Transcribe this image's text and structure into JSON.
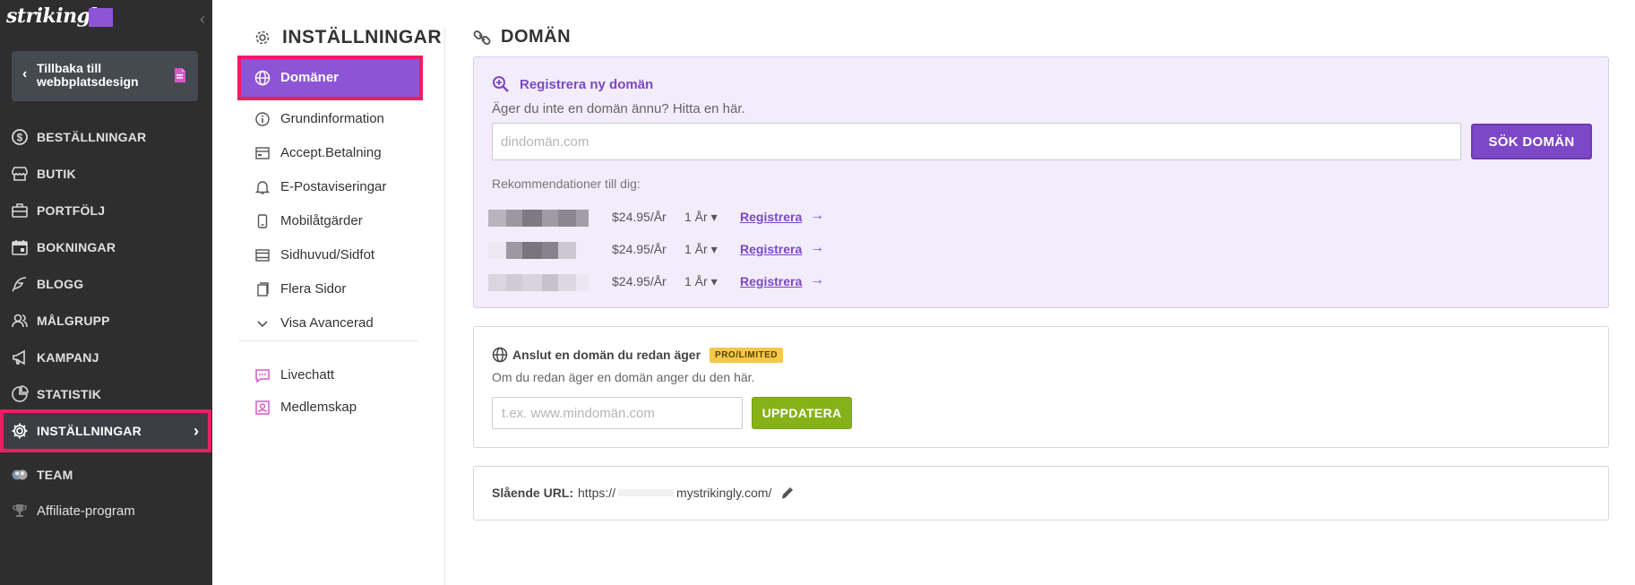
{
  "sidebar": {
    "logo": "strikingly",
    "back_label": "Tillbaka till webbplatsdesign",
    "items": [
      {
        "label": "BESTÄLLNINGAR",
        "icon": "dollar-circle-icon"
      },
      {
        "label": "BUTIK",
        "icon": "store-icon"
      },
      {
        "label": "PORTFÖLJ",
        "icon": "briefcase-icon"
      },
      {
        "label": "BOKNINGAR",
        "icon": "calendar-icon"
      },
      {
        "label": "BLOGG",
        "icon": "feather-icon"
      },
      {
        "label": "MÅLGRUPP",
        "icon": "users-icon"
      },
      {
        "label": "KAMPANJ",
        "icon": "megaphone-icon"
      },
      {
        "label": "STATISTIK",
        "icon": "pie-chart-icon"
      },
      {
        "label": "INSTÄLLNINGAR",
        "icon": "gear-icon"
      },
      {
        "label": "TEAM",
        "icon": "team-icon"
      },
      {
        "label": "Affiliate-program",
        "icon": "trophy-icon"
      }
    ],
    "active": "INSTÄLLNINGAR"
  },
  "settings": {
    "title": "INSTÄLLNINGAR",
    "items": [
      {
        "label": "Domäner",
        "icon": "globe-icon"
      },
      {
        "label": "Grundinformation",
        "icon": "info-icon"
      },
      {
        "label": "Accept.Betalning",
        "icon": "payment-icon"
      },
      {
        "label": "E-Postaviseringar",
        "icon": "bell-icon"
      },
      {
        "label": "Mobilåtgärder",
        "icon": "mobile-icon"
      },
      {
        "label": "Sidhuvud/Sidfot",
        "icon": "layout-icon"
      },
      {
        "label": "Flera Sidor",
        "icon": "pages-icon"
      },
      {
        "label": "Visa Avancerad",
        "icon": "chevron-down-icon"
      }
    ],
    "extras": [
      {
        "label": "Livechatt",
        "icon": "chat-icon"
      },
      {
        "label": "Medlemskap",
        "icon": "membership-icon"
      }
    ],
    "active": "Domäner"
  },
  "main": {
    "title": "DOMÄN",
    "register": {
      "title": "Registrera ny domän",
      "subtitle": "Äger du inte en domän ännu? Hitta en här.",
      "placeholder": "dindomän.com",
      "search_label": "SÖK DOMÄN",
      "rec_label": "Rekommendationer till dig:",
      "recommendations": [
        {
          "price": "$24.95/År",
          "period": "1 År",
          "action": "Registrera"
        },
        {
          "price": "$24.95/År",
          "period": "1 År",
          "action": "Registrera"
        },
        {
          "price": "$24.95/År",
          "period": "1 År",
          "action": "Registrera"
        }
      ]
    },
    "connect": {
      "title": "Anslut en domän du redan äger",
      "badge": "PRO/LIMITED",
      "subtitle": "Om du redan äger en domän anger du den här.",
      "placeholder": "t.ex. www.mindomän.com",
      "update_label": "UPPDATERA"
    },
    "url": {
      "label": "Slående URL:",
      "prefix": "https://",
      "suffix": "mystrikingly.com/"
    }
  },
  "colors": {
    "sidebar_bg": "#2e2e2e",
    "accent_purple": "#7d48c7",
    "highlight_pink": "#ed1e63",
    "update_green": "#86b119",
    "badge_yellow": "#f5c84a"
  }
}
